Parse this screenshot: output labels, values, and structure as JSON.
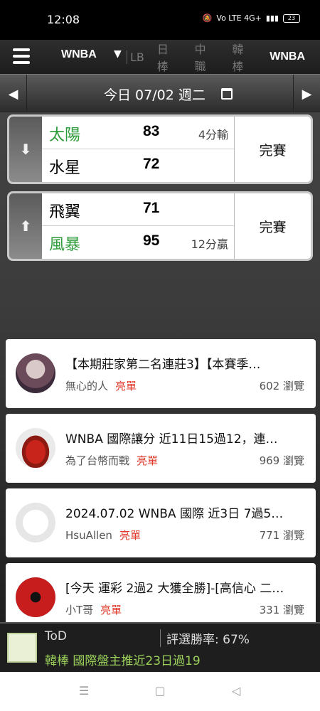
{
  "status_bar": {
    "time": "12:08",
    "icons_text": "Vo LTE 4G+",
    "battery": "23"
  },
  "nav": {
    "selected_league": "WNBA",
    "tabs": [
      {
        "label": "LB",
        "state": "partial"
      },
      {
        "label": "日棒",
        "state": "inactive"
      },
      {
        "label": "中職",
        "state": "inactive"
      },
      {
        "label": "韓棒",
        "state": "inactive"
      },
      {
        "label": "WNBA",
        "state": "active"
      }
    ]
  },
  "date_bar": {
    "label": "今日 07/02 週二",
    "prev": "◀",
    "next": "▶"
  },
  "games": [
    {
      "team1": {
        "name": "太陽",
        "score": "83",
        "color": "#2e9b3a",
        "margin": "4分輸"
      },
      "team2": {
        "name": "水星",
        "score": "72",
        "color": "#111111",
        "margin": ""
      },
      "status": "完賽",
      "arrow": "⬇"
    },
    {
      "team1": {
        "name": "飛翼",
        "score": "71",
        "color": "#111111",
        "margin": ""
      },
      "team2": {
        "name": "風暴",
        "score": "95",
        "color": "#2e9b3a",
        "margin": "12分贏"
      },
      "status": "完賽",
      "arrow": "⬆"
    }
  ],
  "posts": [
    {
      "title": "【本期莊家第二名連莊3】【本賽季…",
      "author": "無心的人",
      "tag": "亮單",
      "views": "602 瀏覽"
    },
    {
      "title": "WNBA 國際讓分 近11日15過12，連…",
      "author": "為了台幣而戰",
      "tag": "亮單",
      "views": "969 瀏覽"
    },
    {
      "title": "2024.07.02 WNBA 國際 近3日 7過5…",
      "author": "HsuAllen",
      "tag": "亮單",
      "views": "771 瀏覽"
    },
    {
      "title": "[今天 運彩 2過2 大獲全勝]-[高信心 二…",
      "author": "小T哥",
      "tag": "亮單",
      "views": "331 瀏覽"
    }
  ],
  "ticker": {
    "name": "ToD",
    "rate": "評選勝率: 67%",
    "text": "韓棒 國際盤主推近23日過19"
  },
  "colors": {
    "win": "#2e9b3a",
    "tag": "#e03a2a",
    "ticker_text": "#9bd15a"
  }
}
